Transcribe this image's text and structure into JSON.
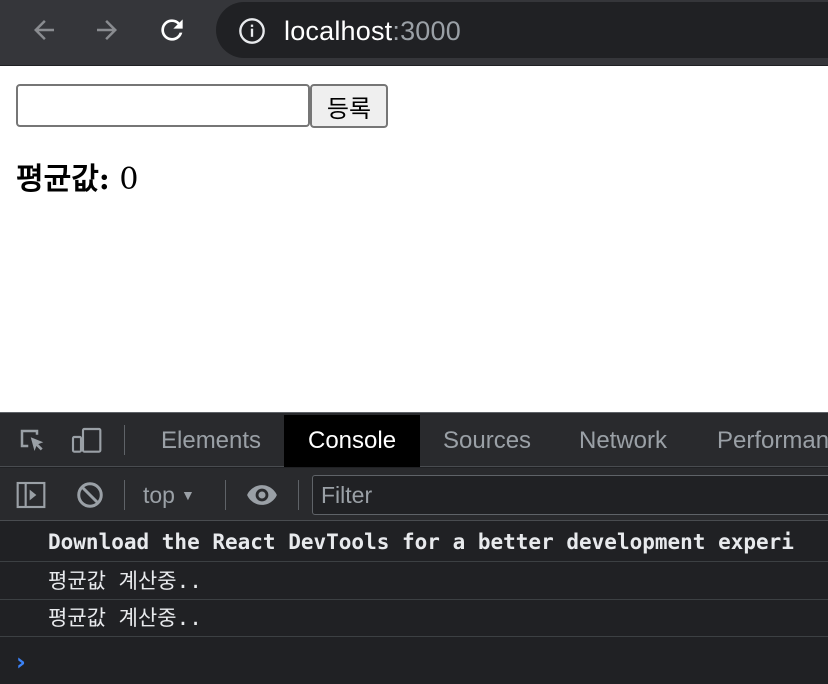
{
  "browser": {
    "url_host": "localhost",
    "url_port": ":3000",
    "icons": [
      "back-arrow-icon",
      "forward-arrow-icon",
      "reload-icon",
      "info-icon"
    ]
  },
  "page": {
    "input_value": "",
    "register_label": "등록",
    "average_label": "평균값:",
    "average_value": "0"
  },
  "devtools": {
    "tabs": [
      {
        "label": "Elements",
        "active": false
      },
      {
        "label": "Console",
        "active": true
      },
      {
        "label": "Sources",
        "active": false
      },
      {
        "label": "Network",
        "active": false
      },
      {
        "label": "Performan",
        "active": false
      }
    ],
    "context": "top",
    "filter_placeholder": "Filter",
    "messages": [
      "Download the React DevTools for a better development experi",
      "평균값 계산중..",
      "평균값 계산중.."
    ],
    "colors": {
      "panel": "#202124",
      "toolbar": "#292a2d",
      "prompt": "#3b82f6"
    }
  }
}
